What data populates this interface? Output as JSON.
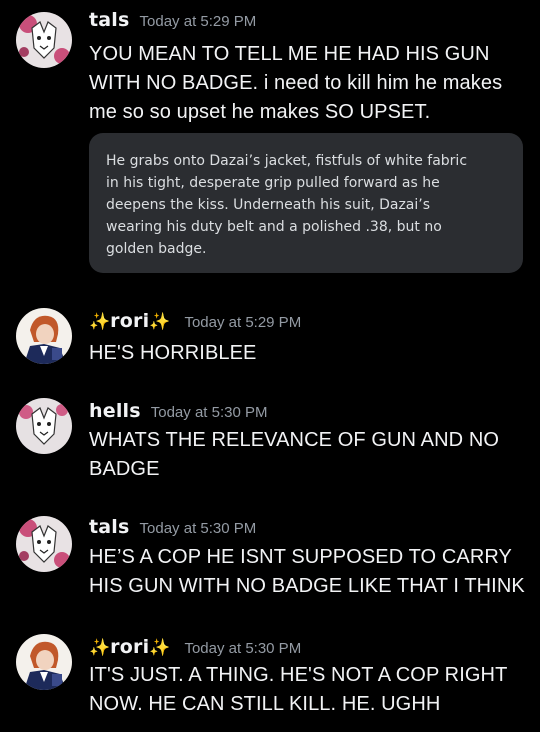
{
  "messages": [
    {
      "id": "m1",
      "username": "tals",
      "timestamp": "Today at 5:29 PM",
      "text": "YOU MEAN TO TELL ME HE HAD HIS GUN WITH NO BADGE. i need to kill him he makes me so so upset he makes SO UPSET.",
      "avatar": "tals-avatar",
      "quote": "He grabs onto Dazai’s jacket, fistfuls of white fabric\nin his tight, desperate grip pulled forward as he\ndeepens the kiss. Underneath his suit, Dazai’s\nwearing his duty belt and a polished .38, but no\ngolden badge."
    },
    {
      "id": "m2",
      "username": "rori",
      "sparkle_left": "✨",
      "sparkle_right": "✨",
      "timestamp": "Today at 5:29 PM",
      "text": "HE'S HORRIBLEE",
      "avatar": "rori-avatar"
    },
    {
      "id": "m3",
      "username": "hells",
      "timestamp": "Today at 5:30 PM",
      "text": "WHATS THE RELEVANCE OF GUN AND NO BADGE",
      "avatar": "hells-avatar"
    },
    {
      "id": "m4",
      "username": "tals",
      "timestamp": "Today at 5:30 PM",
      "text": "HE’S A COP HE ISNT SUPPOSED TO CARRY HIS GUN WITH NO BADGE LIKE THAT I THINK",
      "avatar": "tals-avatar"
    },
    {
      "id": "m5",
      "username": "rori",
      "sparkle_left": "✨",
      "sparkle_right": "✨",
      "timestamp": "Today at 5:30 PM",
      "text": "IT'S JUST. A THING. HE'S NOT A COP RIGHT NOW. HE CAN STILL KILL. HE. UGHH",
      "avatar": "rori-avatar"
    }
  ],
  "colors": {
    "background": "#000000",
    "text": "#f2f3f5",
    "timestamp": "#949ba4",
    "quote_bg": "#2b2d31",
    "sparkle": "#f5c518"
  }
}
